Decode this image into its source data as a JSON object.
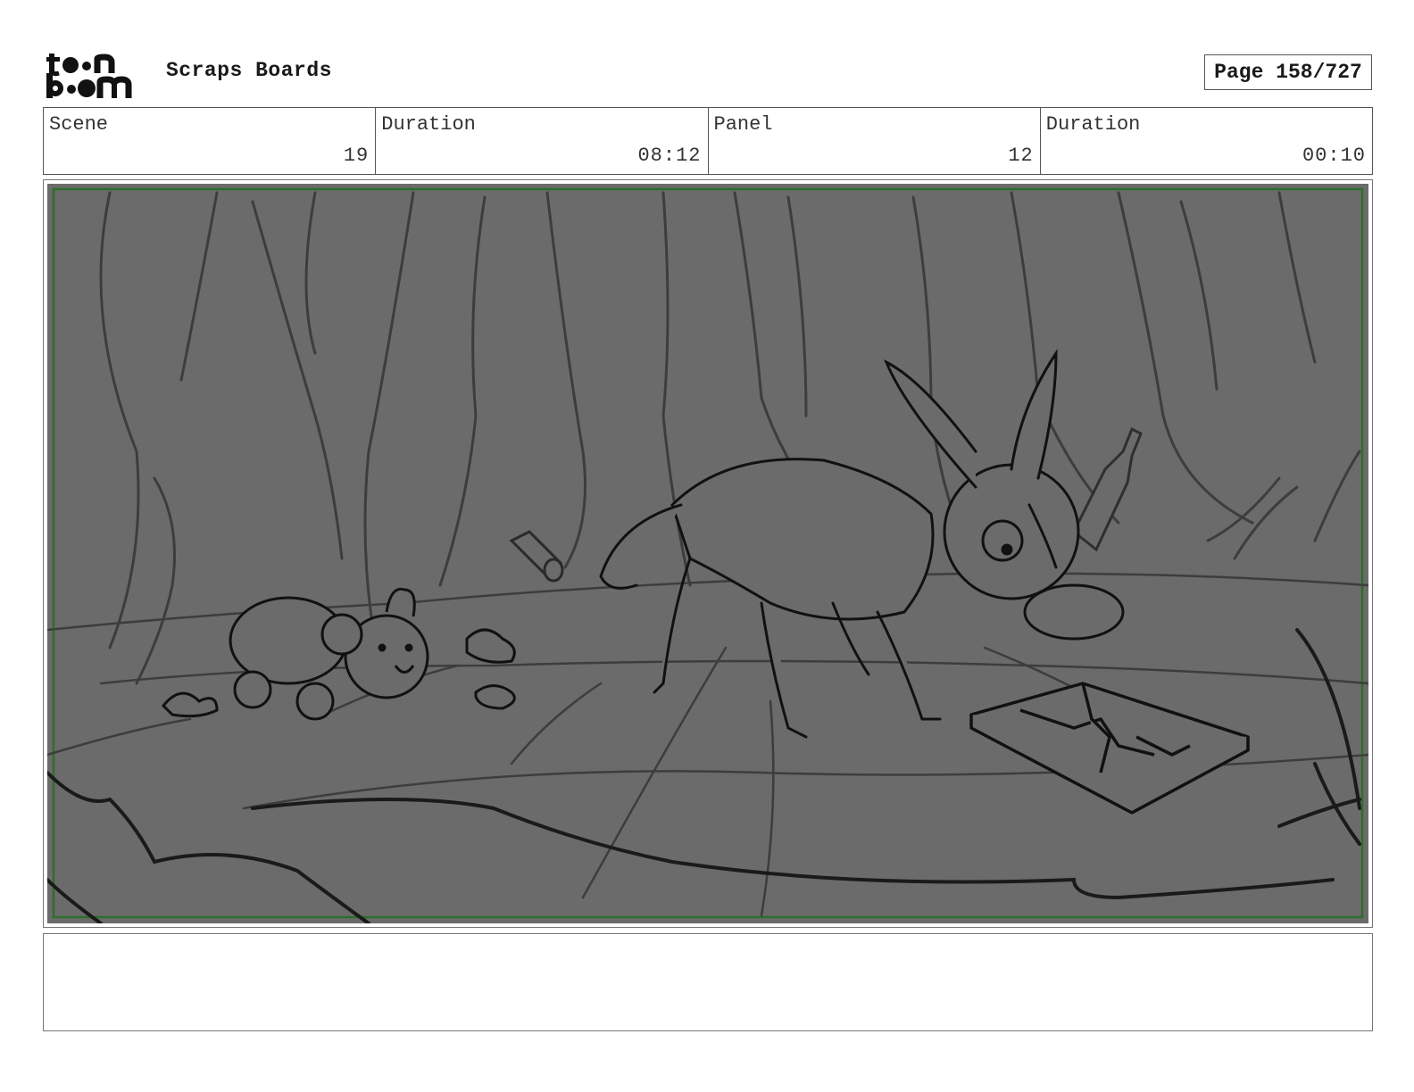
{
  "header": {
    "logo_text": [
      "toon",
      "boom"
    ],
    "title": "Scraps Boards",
    "page_label": "Page 158/727"
  },
  "info": [
    {
      "label": "Scene",
      "value": "19"
    },
    {
      "label": "Duration",
      "value": "08:12"
    },
    {
      "label": "Panel",
      "value": "12"
    },
    {
      "label": "Duration",
      "value": "00:10"
    }
  ],
  "panel": {
    "icons": [
      "teddy-bear-icon",
      "dog-icon",
      "tin-can-icon",
      "bottle-icon",
      "broken-phone-icon",
      "tree-icon"
    ],
    "colors": {
      "background": "#6b6b6b",
      "frame_border": "#2e6e2a",
      "line": "#1a1a1a"
    }
  },
  "notes": {
    "text": ""
  }
}
